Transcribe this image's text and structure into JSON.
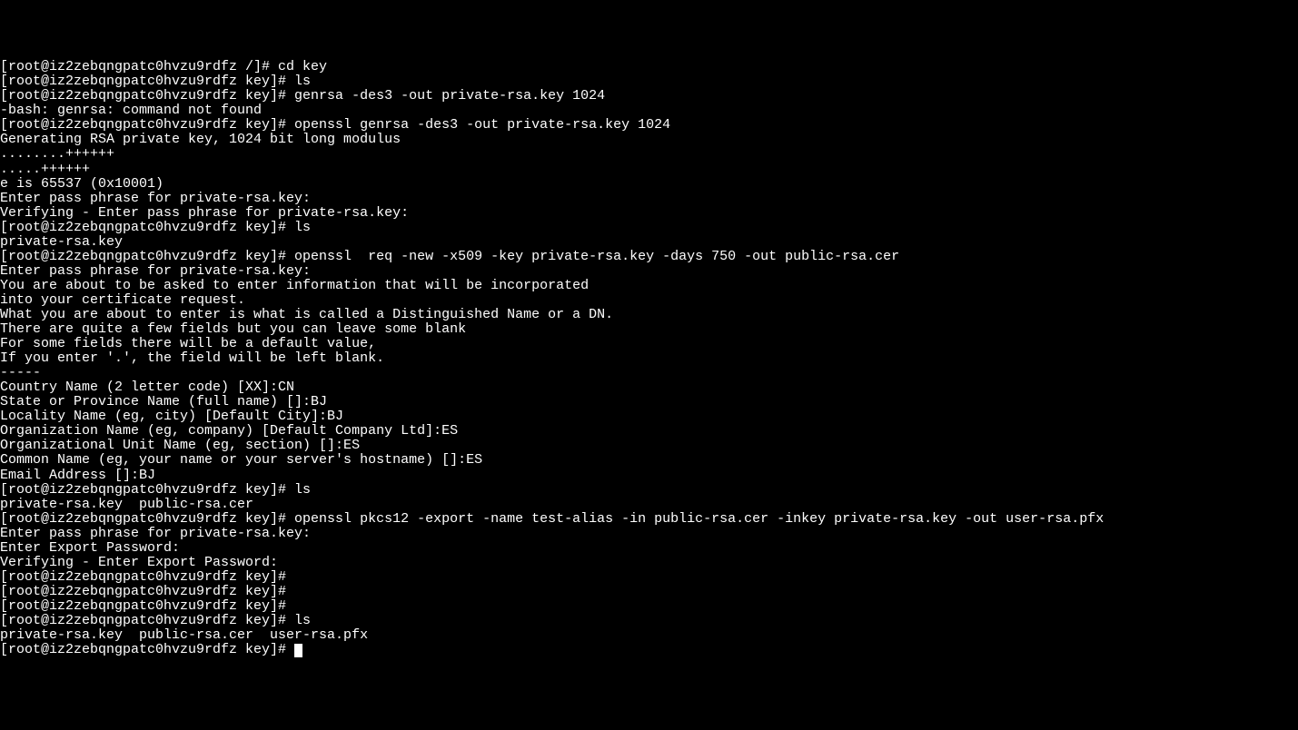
{
  "terminal": {
    "lines": [
      "[root@iz2zebqngpatc0hvzu9rdfz /]# cd key",
      "[root@iz2zebqngpatc0hvzu9rdfz key]# ls",
      "[root@iz2zebqngpatc0hvzu9rdfz key]# genrsa -des3 -out private-rsa.key 1024",
      "-bash: genrsa: command not found",
      "[root@iz2zebqngpatc0hvzu9rdfz key]# openssl genrsa -des3 -out private-rsa.key 1024",
      "Generating RSA private key, 1024 bit long modulus",
      "........++++++",
      ".....++++++",
      "e is 65537 (0x10001)",
      "Enter pass phrase for private-rsa.key:",
      "Verifying - Enter pass phrase for private-rsa.key:",
      "[root@iz2zebqngpatc0hvzu9rdfz key]# ls",
      "private-rsa.key",
      "[root@iz2zebqngpatc0hvzu9rdfz key]# openssl  req -new -x509 -key private-rsa.key -days 750 -out public-rsa.cer",
      "Enter pass phrase for private-rsa.key:",
      "You are about to be asked to enter information that will be incorporated",
      "into your certificate request.",
      "What you are about to enter is what is called a Distinguished Name or a DN.",
      "There are quite a few fields but you can leave some blank",
      "For some fields there will be a default value,",
      "If you enter '.', the field will be left blank.",
      "-----",
      "Country Name (2 letter code) [XX]:CN",
      "State or Province Name (full name) []:BJ",
      "Locality Name (eg, city) [Default City]:BJ",
      "Organization Name (eg, company) [Default Company Ltd]:ES",
      "Organizational Unit Name (eg, section) []:ES",
      "Common Name (eg, your name or your server's hostname) []:ES",
      "Email Address []:BJ",
      "[root@iz2zebqngpatc0hvzu9rdfz key]# ls",
      "private-rsa.key  public-rsa.cer",
      "[root@iz2zebqngpatc0hvzu9rdfz key]# openssl pkcs12 -export -name test-alias -in public-rsa.cer -inkey private-rsa.key -out user-rsa.pfx",
      "Enter pass phrase for private-rsa.key:",
      "Enter Export Password:",
      "Verifying - Enter Export Password:",
      "[root@iz2zebqngpatc0hvzu9rdfz key]# ",
      "[root@iz2zebqngpatc0hvzu9rdfz key]# ",
      "[root@iz2zebqngpatc0hvzu9rdfz key]# ",
      "[root@iz2zebqngpatc0hvzu9rdfz key]# ls",
      "private-rsa.key  public-rsa.cer  user-rsa.pfx",
      "[root@iz2zebqngpatc0hvzu9rdfz key]# "
    ],
    "cursor_line": 40
  }
}
